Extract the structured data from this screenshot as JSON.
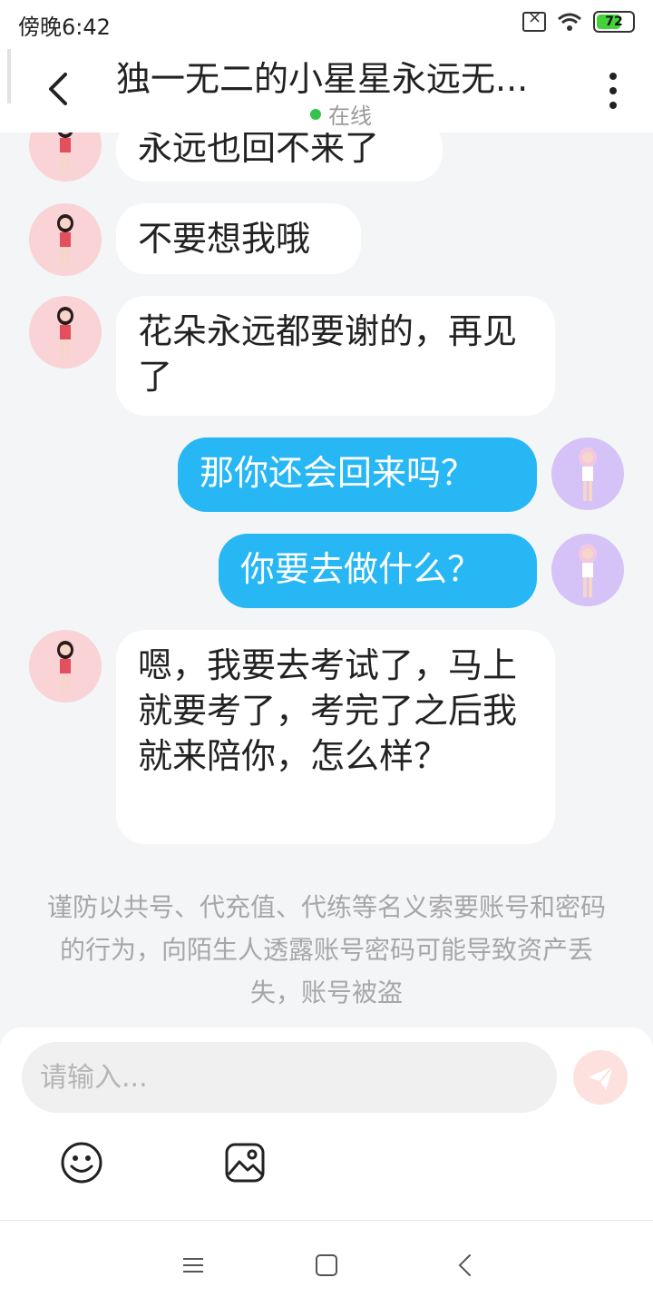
{
  "status_bar": {
    "time": "傍晚6:42",
    "battery": "72"
  },
  "header": {
    "title": "独一无二的小星星永远无...",
    "status": "在线"
  },
  "messages": [
    {
      "side": "left",
      "text": "永远也回不来了"
    },
    {
      "side": "left",
      "text": "不要想我哦"
    },
    {
      "side": "left",
      "text": "花朵永远都要谢的，再见了"
    },
    {
      "side": "right",
      "text": "那你还会回来吗？"
    },
    {
      "side": "right",
      "text": "你要去做什么？"
    },
    {
      "side": "left",
      "text": "嗯，我要去考试了，马上就要考了，考完了之后我就来陪你，怎么样？"
    }
  ],
  "notice": "谨防以共号、代充值、代练等名义索要账号和密码的行为，向陌生人透露账号密码可能导致资产丢失，账号被盗",
  "input": {
    "placeholder": "请输入..."
  },
  "colors": {
    "sent_bubble": "#26b7f4",
    "received_bubble": "#ffffff",
    "online": "#35c24b",
    "send_button": "#fde1de"
  }
}
